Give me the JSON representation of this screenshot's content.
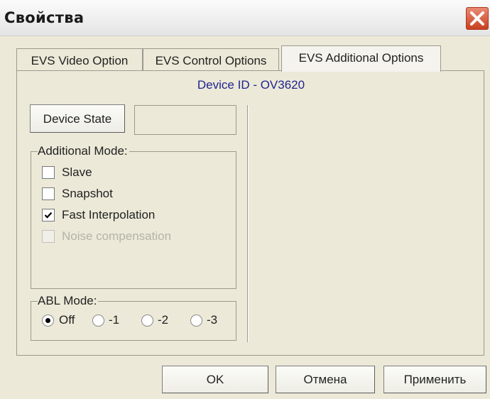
{
  "window": {
    "title": "Свойства"
  },
  "tabs": [
    {
      "label": "EVS Video Option",
      "active": false
    },
    {
      "label": "EVS Control Options",
      "active": false
    },
    {
      "label": "EVS Additional Options",
      "active": true
    }
  ],
  "panel": {
    "device_id": "Device ID - OV3620",
    "device_state_button": "Device State",
    "device_state_value": "",
    "additional_mode": {
      "legend": "Additional Mode:",
      "options": [
        {
          "label": "Slave",
          "checked": false,
          "enabled": true
        },
        {
          "label": "Snapshot",
          "checked": false,
          "enabled": true
        },
        {
          "label": "Fast Interpolation",
          "checked": true,
          "enabled": true
        },
        {
          "label": "Noise compensation",
          "checked": false,
          "enabled": false
        }
      ]
    },
    "abl_mode": {
      "legend": "ABL Mode:",
      "options": [
        {
          "label": "Off",
          "selected": true
        },
        {
          "label": "-1",
          "selected": false
        },
        {
          "label": "-2",
          "selected": false
        },
        {
          "label": "-3",
          "selected": false
        }
      ]
    }
  },
  "buttons": {
    "ok": "OK",
    "cancel": "Отмена",
    "apply": "Применить"
  },
  "colors": {
    "device_id_text": "#1f2590",
    "close_button": "#d9542f"
  }
}
